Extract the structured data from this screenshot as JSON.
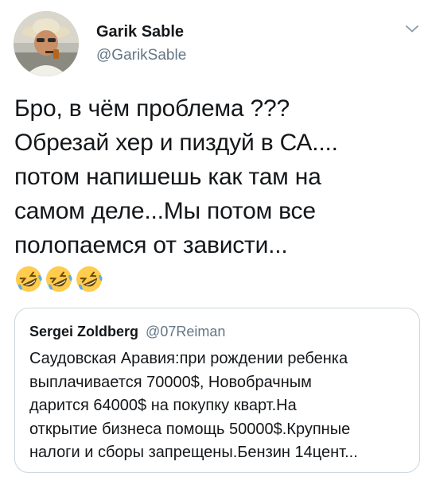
{
  "author": {
    "name": "Garik Sable",
    "handle": "@GarikSable",
    "avatar_icon": "user-avatar-photo"
  },
  "menu": {
    "icon": "chevron-down-icon"
  },
  "tweet": {
    "lines": [
      "Бро, в чём проблема ???",
      "Обрезай хер и пиздуй в СА....",
      "потом напишешь как там на",
      "самом деле...Мы потом все",
      "полопаемся от зависти..."
    ],
    "emojis": [
      "rolling-on-the-floor-laughing",
      "rolling-on-the-floor-laughing",
      "rolling-on-the-floor-laughing"
    ]
  },
  "quoted_tweet": {
    "name": "Sergei Zoldberg",
    "handle": "@07Reiman",
    "lines": [
      "Саудовская Аравия:при рождении ребенка",
      "выплачивается 70000$, Новобрачным",
      "дарится 64000$ на покупку кварт.На",
      "открытие бизнеса помощь 50000$.Крупные",
      "налоги и сборы запрещены.Бензин 14цент..."
    ]
  },
  "colors": {
    "text": "#14171a",
    "secondary": "#657786",
    "border": "#ccd6dd"
  }
}
